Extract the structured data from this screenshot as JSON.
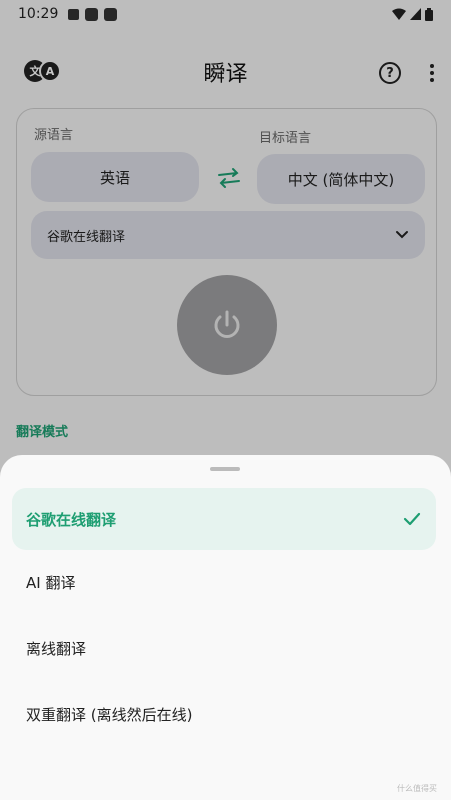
{
  "status": {
    "time": "10:29"
  },
  "app": {
    "title": "瞬译",
    "lang_icon_a": "文",
    "lang_icon_b": "A",
    "help_icon_glyph": "?"
  },
  "card": {
    "source_label": "源语言",
    "source_value": "英语",
    "target_label": "目标语言",
    "target_value": "中文 (简体中文)",
    "engine_value": "谷歌在线翻译"
  },
  "mode_title": "翻译模式",
  "sheet": {
    "options": [
      {
        "label": "谷歌在线翻译",
        "selected": true
      },
      {
        "label": "AI 翻译",
        "selected": false
      },
      {
        "label": "离线翻译",
        "selected": false
      },
      {
        "label": "双重翻译 (离线然后在线)",
        "selected": false
      }
    ]
  },
  "watermark": "什么值得买",
  "colors": {
    "accent": "#1e9e72",
    "pill": "#dcdde6",
    "power": "#9e9ea0"
  },
  "icons": [
    "translate-icon",
    "help-icon",
    "more-vert-icon",
    "swap-icon",
    "chevron-down-icon",
    "power-icon",
    "check-icon"
  ]
}
